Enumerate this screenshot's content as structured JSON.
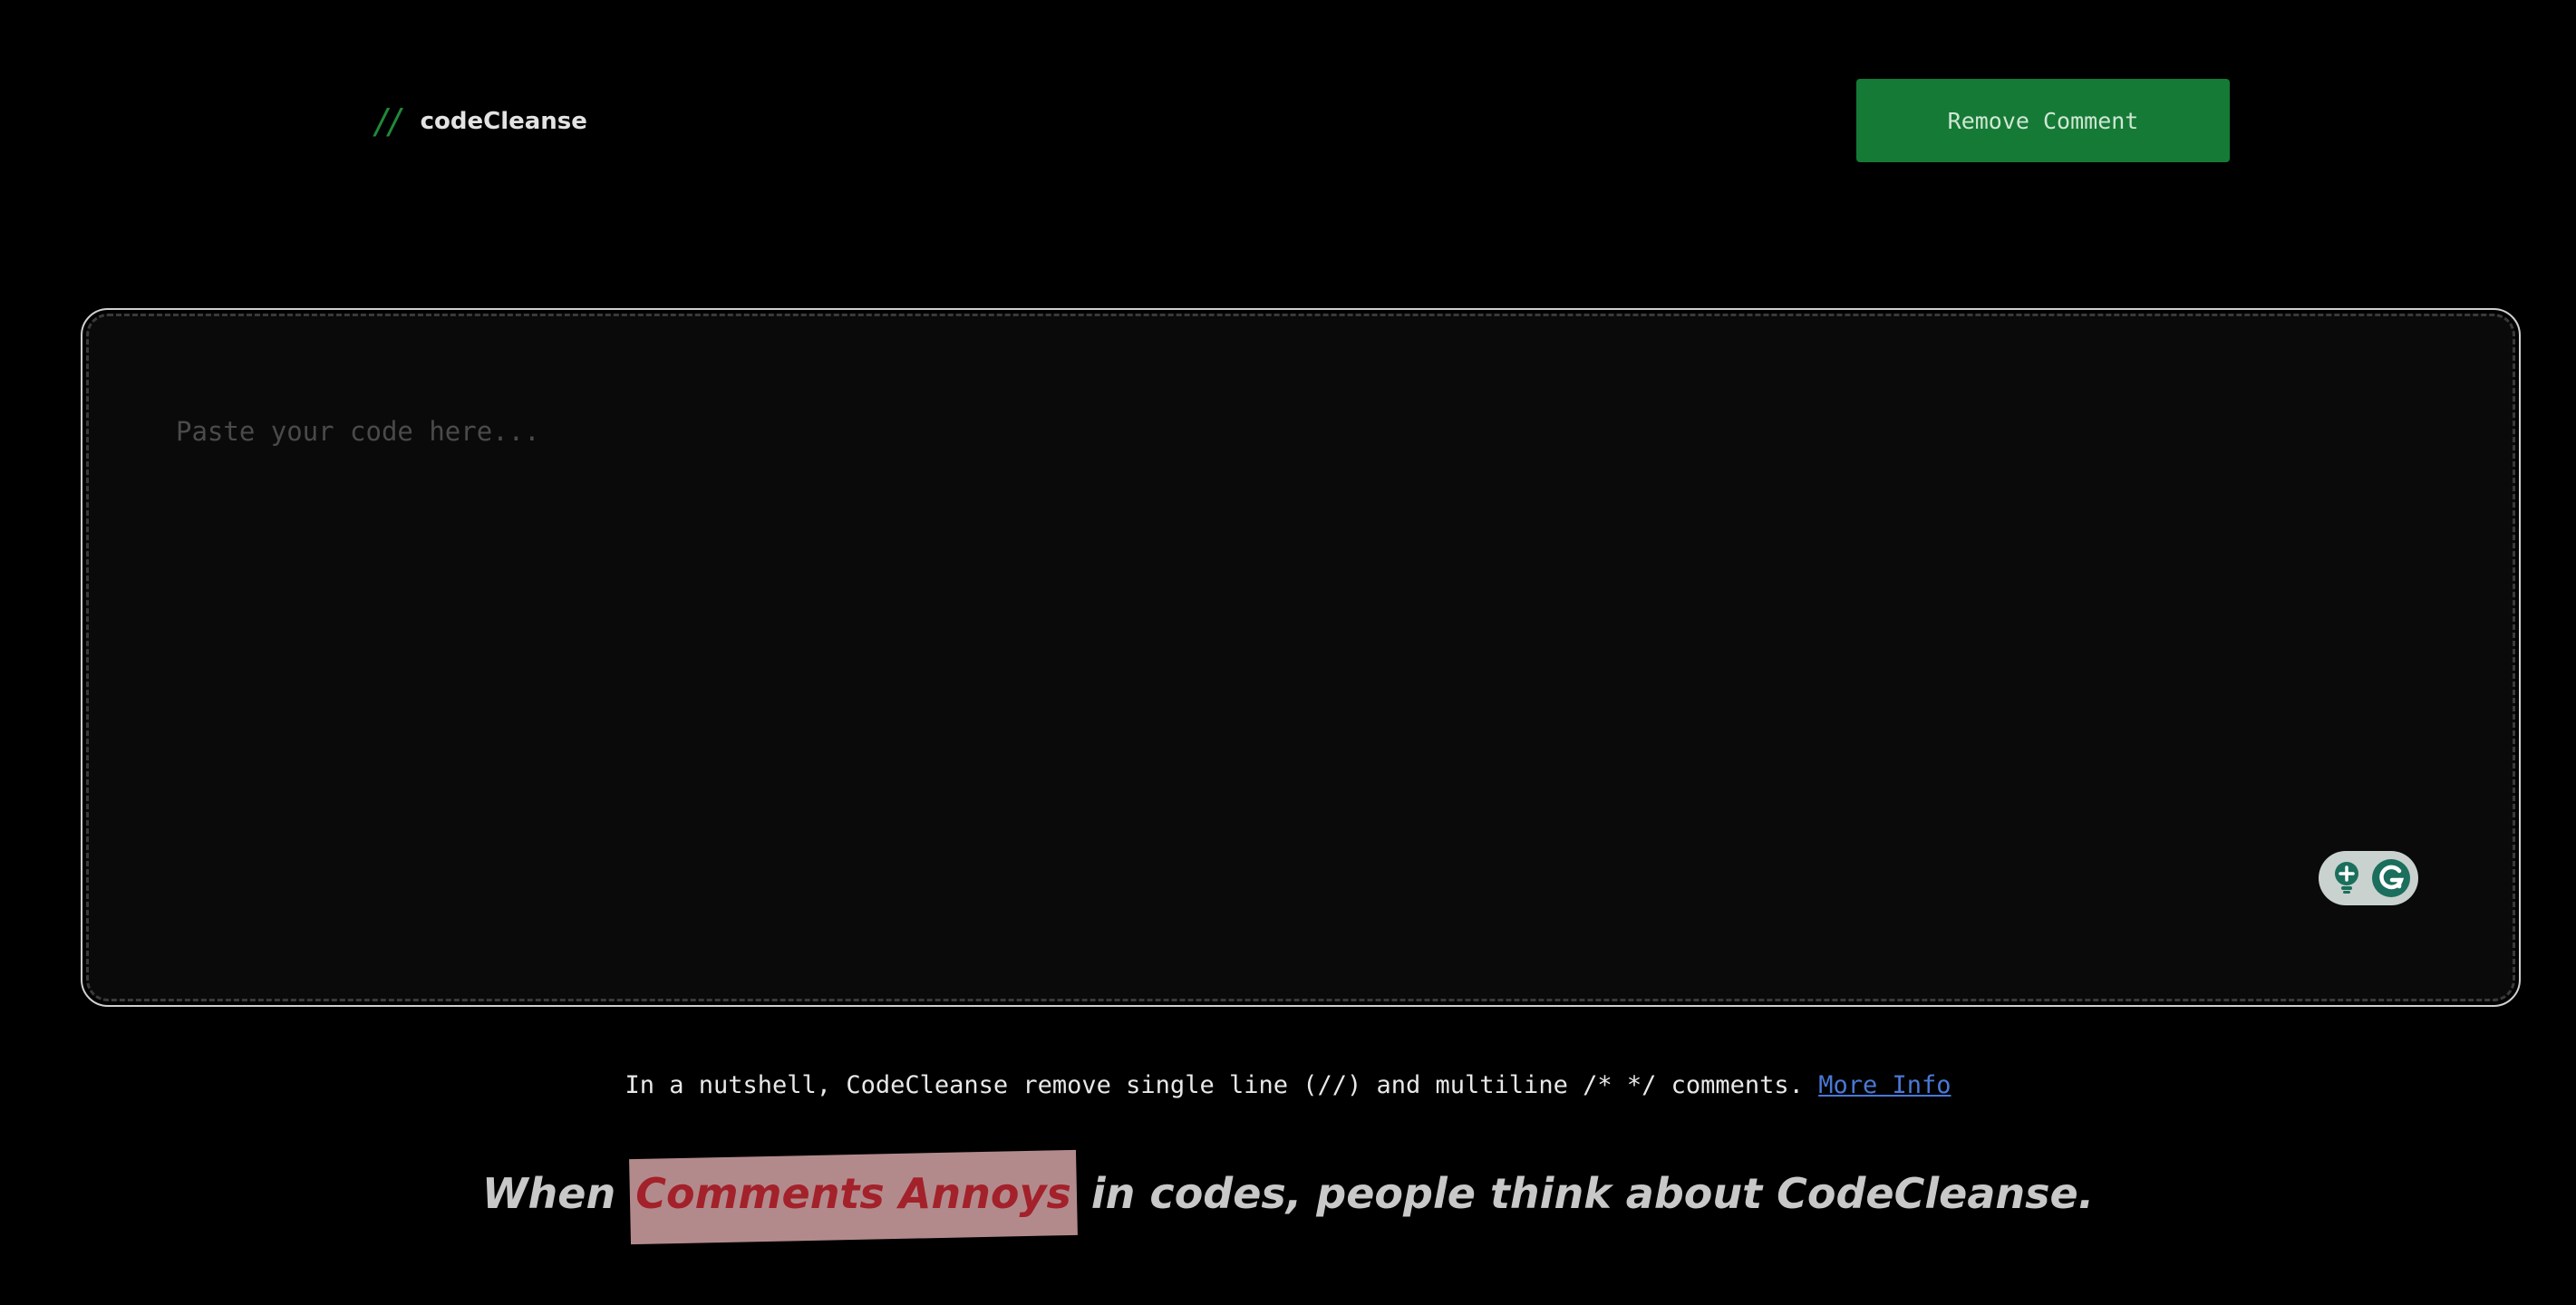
{
  "header": {
    "logo_slashes": "//",
    "logo_text": "codeCleanse",
    "remove_button_label": "Remove Comment"
  },
  "editor": {
    "placeholder": "Paste your code here...",
    "value": ""
  },
  "info": {
    "text": "In a nutshell, CodeCleanse remove single line (//) and multiline /* */ comments.",
    "link_label": "More Info"
  },
  "tagline": {
    "before": "When",
    "highlight": "Comments Annoys",
    "after": "in codes, people think about CodeCleanse."
  },
  "colors": {
    "accent_green": "#157a35",
    "link_blue": "#4a78d6",
    "highlight_red": "#a3212a",
    "highlight_bg": "#b38a8c"
  },
  "icons": {
    "logo_icon": "double-slash-icon",
    "grammarly_bulb": "grammarly-bulb-icon",
    "grammarly_logo": "grammarly-g-icon"
  }
}
